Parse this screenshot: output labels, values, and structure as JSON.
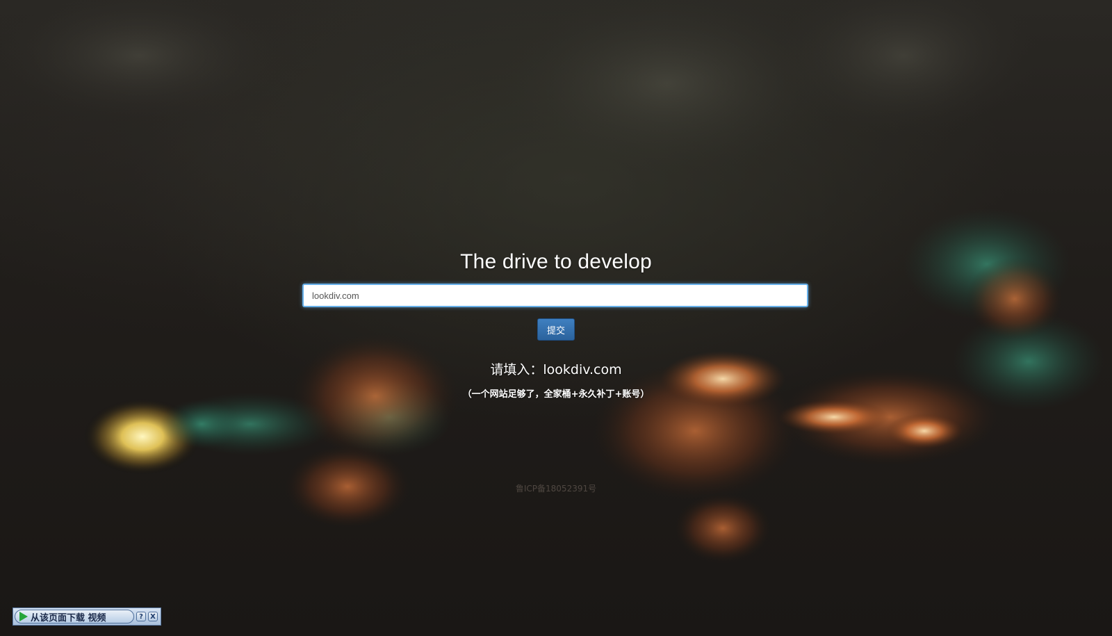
{
  "page": {
    "title": "The drive to develop"
  },
  "search": {
    "value": "lookdiv.com",
    "placeholder": ""
  },
  "submit": {
    "label": "提交"
  },
  "prompt": {
    "text": "请填入：lookdiv.com"
  },
  "note": {
    "text": "（一个网站足够了，全家桶+永久补丁+账号）"
  },
  "footer": {
    "icp": "鲁ICP备18052391号"
  },
  "download_bar": {
    "label": "从该页面下载 视频",
    "help": "?",
    "close": "X",
    "icons": [
      "play-icon",
      "help-icon",
      "close-icon"
    ]
  },
  "colors": {
    "accent_button": "#2b639d",
    "input_focus": "#66afe9",
    "background": "#1c1916"
  }
}
